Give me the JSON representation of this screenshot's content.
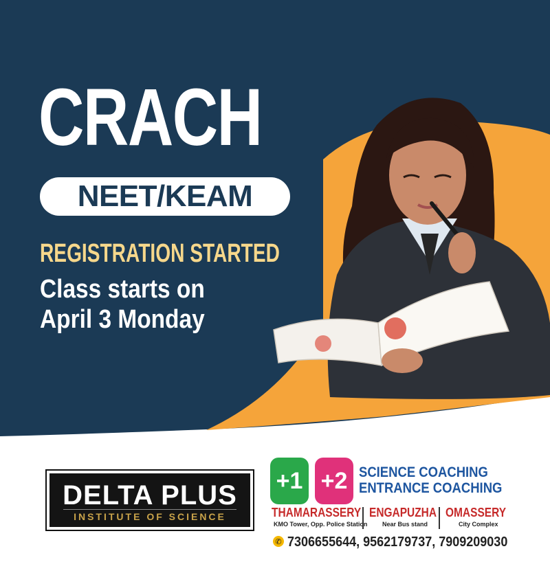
{
  "headline": {
    "title": "CRACH",
    "exam": "NEET/KEAM",
    "registration": "REGISTRATION STARTED",
    "class_line1": "Class starts on",
    "class_line2": "April 3 Monday"
  },
  "logo": {
    "name": "DELTA PLUS",
    "subtitle": "INSTITUTE OF SCIENCE"
  },
  "badges": [
    "+1",
    "+2"
  ],
  "coaching": {
    "line1": "SCIENCE COACHING",
    "line2": "ENTRANCE COACHING"
  },
  "locations": [
    {
      "name": "THAMARASSERY",
      "detail": "KMO Tower, Opp. Police Station"
    },
    {
      "name": "ENGAPUZHA",
      "detail": "Near Bus stand"
    },
    {
      "name": "OMASSERY",
      "detail": "City Complex"
    }
  ],
  "phones": "7306655644, 9562179737, 7909209030",
  "icons": {
    "phone": "phone-icon"
  },
  "colors": {
    "navy": "#1b3a55",
    "orange": "#f5a43a",
    "gold_text": "#f6d78b",
    "plus_one": "#2aa84a",
    "plus_two": "#e0317a",
    "coaching_blue": "#1e56a0",
    "location_red": "#c62a2a"
  }
}
